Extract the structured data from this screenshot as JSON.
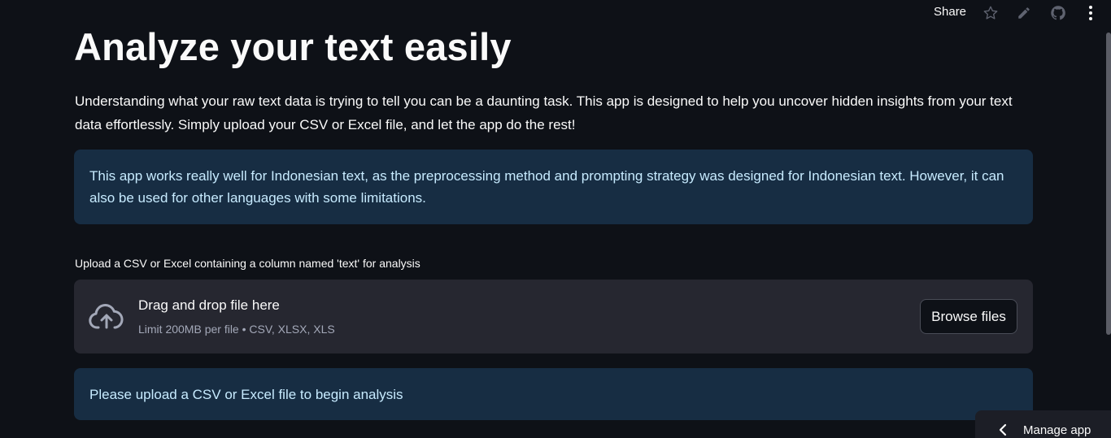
{
  "toolbar": {
    "share_label": "Share",
    "icons": [
      "star-icon",
      "pencil-icon",
      "github-icon",
      "kebab-menu-icon"
    ]
  },
  "main": {
    "title": "Analyze your text easily",
    "intro": "Understanding what your raw text data is trying to tell you can be a daunting task. This app is designed to help you uncover hidden insights from your text data effortlessly. Simply upload your CSV or Excel file, and let the app do the rest!",
    "info_language": "This app works really well for Indonesian text, as the preprocessing method and prompting strategy was designed for Indonesian text. However, it can also be used for other languages with some limitations.",
    "uploader": {
      "label": "Upload a CSV or Excel containing a column named 'text' for analysis",
      "drop_title": "Drag and drop file here",
      "limit_text": "Limit 200MB per file • CSV, XLSX, XLS",
      "browse_label": "Browse files",
      "icon": "cloud-upload-icon"
    },
    "info_upload": "Please upload a CSV or Excel file to begin analysis"
  },
  "manage_app": {
    "label": "Manage app",
    "icon": "chevron-left-icon"
  },
  "colors": {
    "background": "#0e1117",
    "info_bg": "#172d43",
    "info_text": "#c7ebff",
    "dropzone_bg": "#262730"
  }
}
